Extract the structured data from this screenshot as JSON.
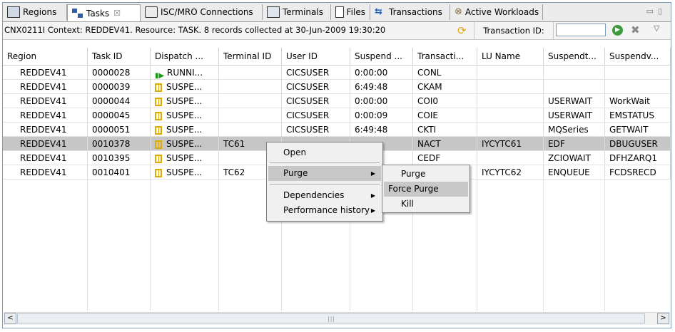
{
  "tabs": [
    {
      "label": "Regions",
      "icon": "regions-icon"
    },
    {
      "label": "Tasks",
      "icon": "tasks-icon",
      "active": true,
      "close": "☒"
    },
    {
      "label": "ISC/MRO Connections",
      "icon": "isc-icon"
    },
    {
      "label": "Terminals",
      "icon": "terminals-icon"
    },
    {
      "label": "Files",
      "icon": "files-icon"
    },
    {
      "label": "Transactions",
      "icon": "transactions-icon"
    },
    {
      "label": "Active Workloads",
      "icon": "active-workloads-icon"
    }
  ],
  "window_controls": {
    "minimize": "▭",
    "maximize": "▯"
  },
  "status": {
    "text": "CNX0211I Context: REDDEV41. Resource: TASK. 8 records collected at 30-Jun-2009 19:30:20",
    "filter_label": "Transaction ID:",
    "filter_value": ""
  },
  "columns": [
    "Region",
    "Task ID",
    "Dispatch ...",
    "Terminal ID",
    "User ID",
    "Suspend ...",
    "Transacti...",
    "LU Name",
    "Suspendt...",
    "Suspendv..."
  ],
  "rows": [
    {
      "region": "REDDEV41",
      "task_id": "0000028",
      "dispatch": "RUNNI...",
      "dispatch_icon": "running-icon",
      "terminal": "",
      "user": "CICSUSER",
      "suspend": "0:00:00",
      "transaction": "CONL",
      "lu": "",
      "suspendtype": "",
      "suspendvalue": ""
    },
    {
      "region": "REDDEV41",
      "task_id": "0000039",
      "dispatch": "SUSPE...",
      "dispatch_icon": "suspended-icon",
      "terminal": "",
      "user": "CICSUSER",
      "suspend": "6:49:48",
      "transaction": "CKAM",
      "lu": "",
      "suspendtype": "",
      "suspendvalue": ""
    },
    {
      "region": "REDDEV41",
      "task_id": "0000044",
      "dispatch": "SUSPE...",
      "dispatch_icon": "suspended-icon",
      "terminal": "",
      "user": "CICSUSER",
      "suspend": "0:00:00",
      "transaction": "COI0",
      "lu": "",
      "suspendtype": "USERWAIT",
      "suspendvalue": "WorkWait"
    },
    {
      "region": "REDDEV41",
      "task_id": "0000045",
      "dispatch": "SUSPE...",
      "dispatch_icon": "suspended-icon",
      "terminal": "",
      "user": "CICSUSER",
      "suspend": "0:00:09",
      "transaction": "COIE",
      "lu": "",
      "suspendtype": "USERWAIT",
      "suspendvalue": "EMSTATUS"
    },
    {
      "region": "REDDEV41",
      "task_id": "0000051",
      "dispatch": "SUSPE...",
      "dispatch_icon": "suspended-icon",
      "terminal": "",
      "user": "CICSUSER",
      "suspend": "6:49:48",
      "transaction": "CKTI",
      "lu": "",
      "suspendtype": "MQSeries",
      "suspendvalue": "GETWAIT"
    },
    {
      "region": "REDDEV41",
      "task_id": "0010378",
      "dispatch": "SUSPE...",
      "dispatch_icon": "suspended-icon",
      "terminal": "TC61",
      "user": "",
      "suspend": "",
      "transaction": "NACT",
      "lu": "IYCYTC61",
      "suspendtype": "EDF",
      "suspendvalue": "DBUGUSER",
      "selected": true
    },
    {
      "region": "REDDEV41",
      "task_id": "0010395",
      "dispatch": "SUSPE...",
      "dispatch_icon": "suspended-icon",
      "terminal": "",
      "user": "",
      "suspend": "",
      "transaction": "CEDF",
      "lu": "",
      "suspendtype": "ZCIOWAIT",
      "suspendvalue": "DFHZARQ1"
    },
    {
      "region": "REDDEV41",
      "task_id": "0010401",
      "dispatch": "SUSPE...",
      "dispatch_icon": "suspended-icon",
      "terminal": "TC62",
      "user": "",
      "suspend": "",
      "transaction": "",
      "lu": "IYCYTC62",
      "suspendtype": "ENQUEUE",
      "suspendvalue": "FCDSRECD"
    }
  ],
  "context_menu": {
    "items": [
      "Open",
      "Purge",
      "Dependencies",
      "Performance history"
    ],
    "highlighted": "Purge"
  },
  "submenu": {
    "items": [
      "Purge",
      "Force Purge",
      "Kill"
    ],
    "highlighted": "Force Purge"
  },
  "scrollbar": {
    "left": "<",
    "right": ">",
    "grip": "|||"
  }
}
